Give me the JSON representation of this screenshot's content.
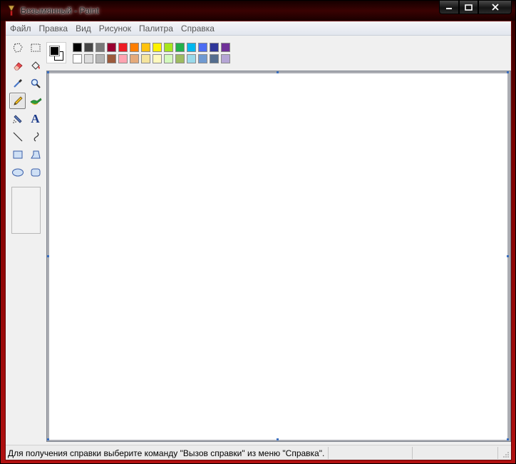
{
  "window": {
    "title": "Безымянный - Paint",
    "controls": {
      "minimize": "minimize",
      "maximize": "maximize",
      "close": "close"
    }
  },
  "menu": {
    "items": [
      "Файл",
      "Правка",
      "Вид",
      "Рисунок",
      "Палитра",
      "Справка"
    ]
  },
  "tools": [
    {
      "name": "free-select",
      "icon": "free-form-select-icon"
    },
    {
      "name": "rect-select",
      "icon": "rect-select-icon"
    },
    {
      "name": "eraser",
      "icon": "eraser-icon"
    },
    {
      "name": "fill",
      "icon": "fill-bucket-icon"
    },
    {
      "name": "pick-color",
      "icon": "eyedropper-icon"
    },
    {
      "name": "magnifier",
      "icon": "magnifier-icon"
    },
    {
      "name": "pencil",
      "icon": "pencil-icon",
      "active": true
    },
    {
      "name": "brush",
      "icon": "brush-icon"
    },
    {
      "name": "airbrush",
      "icon": "airbrush-icon"
    },
    {
      "name": "text",
      "icon": "text-icon",
      "glyph": "A"
    },
    {
      "name": "line",
      "icon": "line-icon"
    },
    {
      "name": "curve",
      "icon": "curve-icon"
    },
    {
      "name": "rectangle",
      "icon": "rectangle-icon"
    },
    {
      "name": "polygon",
      "icon": "polygon-icon"
    },
    {
      "name": "ellipse",
      "icon": "ellipse-icon"
    },
    {
      "name": "rounded-rectangle",
      "icon": "rounded-rectangle-icon"
    }
  ],
  "palette": {
    "foreground": "#000000",
    "background": "#ffffff",
    "top_row": [
      "#000000",
      "#464646",
      "#787878",
      "#990030",
      "#ed1c24",
      "#ff7e00",
      "#ffc20e",
      "#fff200",
      "#a8e61d",
      "#22b14c",
      "#00b7ef",
      "#4d6df3",
      "#2f3699",
      "#6f3198"
    ],
    "bottom_row": [
      "#ffffff",
      "#dcdcdc",
      "#b4b4b4",
      "#9c5a3c",
      "#ffa3b1",
      "#e5aa7a",
      "#f5e49c",
      "#fff9bd",
      "#d3f9bc",
      "#9dbb61",
      "#99d9ea",
      "#709ad1",
      "#546d8e",
      "#b5a5d5"
    ]
  },
  "status": {
    "text": "Для получения справки выберите команду \"Вызов справки\" из меню \"Справка\"."
  }
}
